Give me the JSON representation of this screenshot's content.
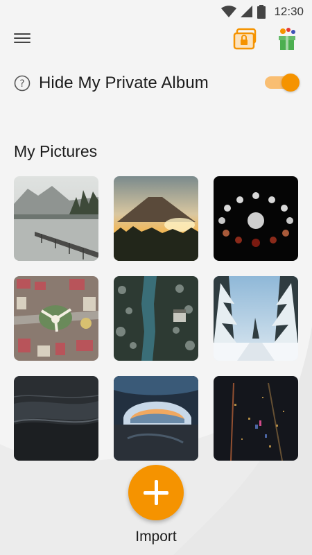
{
  "status_bar": {
    "time": "12:30",
    "icons": [
      "wifi-icon",
      "signal-icon",
      "battery-icon"
    ]
  },
  "app_bar": {
    "menu_icon": "menu-icon",
    "lock_album_icon": "locked-album-icon",
    "gift_icon": "gift-icon"
  },
  "hide_album": {
    "label": "Hide My Private Album",
    "enabled": true
  },
  "section": {
    "title": "My Pictures"
  },
  "pictures": [
    {
      "subject": "lake with wooden pier and mountains"
    },
    {
      "subject": "volcano mountain at sunset"
    },
    {
      "subject": "lunar eclipse phases"
    },
    {
      "subject": "aerial city roundabout"
    },
    {
      "subject": "aerial river through snowy forest"
    },
    {
      "subject": "snowy forest road"
    },
    {
      "subject": "dark ocean waves on beach"
    },
    {
      "subject": "ice cave arch"
    },
    {
      "subject": "city at night from above"
    }
  ],
  "fab": {
    "label": "Import"
  },
  "colors": {
    "accent": "#f59300",
    "accent_light": "#f9be72",
    "background": "#f4f4f4"
  }
}
